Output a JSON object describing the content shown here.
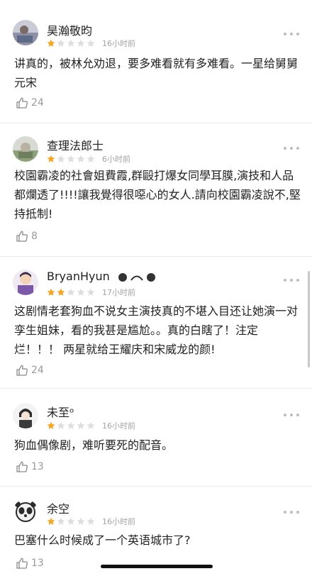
{
  "reviews": [
    {
      "user": "昊瀚敬昀",
      "stars": 1,
      "time": "16小时前",
      "text": "讲真的，被林允劝退，要多难看就有多难看。一星给舅舅元宋",
      "likes": "24",
      "avatar_icon": "photo-avatar-icon"
    },
    {
      "user": "查理法郎士",
      "stars": 1,
      "time": "6小时前",
      "text": "校園霸凌的社會姐費霞,群毆打爆女同學耳膜,演技和人品都爛透了!!!!讓我覺得很噁心的女人.請向校園霸凌說不,堅持抵制!",
      "likes": "8",
      "avatar_icon": "landscape-avatar-icon"
    },
    {
      "user": "BryanHyun",
      "stars": 2,
      "time": "17小时前",
      "text": "这剧情老套狗血不说女主演技真的不堪入目还让她演一对孪生姐妹，看的我甚是尴尬。。真的白瞎了！注定烂！！！ 两星就给王耀庆和宋威龙的颜!",
      "likes": "24",
      "avatar_icon": "cartoon-avatar-icon"
    },
    {
      "user": "未至ᵒ",
      "stars": 1,
      "time": "16小时前",
      "text": "狗血偶像剧，难听要死的配音。",
      "likes": "13",
      "avatar_icon": "anime-avatar-icon"
    },
    {
      "user": "余空",
      "stars": 1,
      "time": "16小时前",
      "text": "巴塞什么时候成了一个英语城市了?",
      "likes": "13",
      "avatar_icon": "panda-avatar-icon"
    }
  ],
  "colors": {
    "star_filled": "#f5a623",
    "star_empty": "#dedede",
    "secondary_text": "#a3a3a3",
    "divider": "#ececec"
  }
}
